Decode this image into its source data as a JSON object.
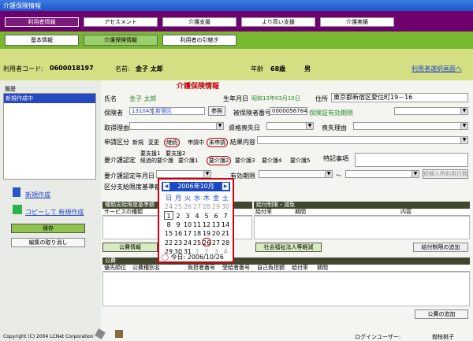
{
  "window": {
    "title": "介護保険情報"
  },
  "top_tabs": [
    "利用者情報",
    "アセスメント",
    "介護支援",
    "より高い支援",
    "介護実績"
  ],
  "sub_tabs": [
    "基本情報",
    "介護保険情報",
    "利用者の引継ぎ"
  ],
  "user": {
    "code_label": "利用者コード:",
    "code": "0600018197",
    "name_label": "名前:",
    "name": "金子 太郎",
    "age_label": "年齢",
    "age": "68歳",
    "gender": "男",
    "select_link": "利用者選択画面へ"
  },
  "sidebar": {
    "history_label": "履歴",
    "history_item": "新規作成中",
    "new_link": "新規作成",
    "copy_link": "コピーして 新規作成",
    "save": "保存",
    "cancel": "編集の取り消し"
  },
  "form": {
    "title": "介護保険情報",
    "name_label": "氏名",
    "name": "金子 太郎",
    "birth_label": "生年月日",
    "birth": "昭和13年03月10日",
    "address_label": "住所",
    "address": "東京都新宿区愛住町19－16",
    "insurer_label": "保険者",
    "insurer_code": "131045",
    "insurer_name": "新宿区",
    "ref": "参照",
    "insured_no_label": "被保険者番号",
    "insured_no": "0000056784",
    "cert_label": "保険証有効期限",
    "acq_label": "取得理由",
    "loss_label": "資格喪失日",
    "loss_reason_label": "喪失理由",
    "app_label": "申請区分",
    "app_opts": [
      "新規",
      "変更",
      "継続",
      "申請中",
      "未申請"
    ],
    "result_label": "結果内容",
    "care_label": "要介護認定",
    "care_row1": [
      "要支援1",
      "要支援2"
    ],
    "care_row2": [
      "経過的要介護",
      "要介護1",
      "要介護2",
      "要介護3",
      "要介護4",
      "要介護5"
    ],
    "special_label": "特記事項",
    "care_date_label": "要介護認定年月日",
    "valid_label": "有効期限",
    "tilde": "～",
    "short_btn": "短期入所利用日数",
    "limit_label": "区分支給限度基準額",
    "type_section": "種類支給限度基準額",
    "service_col": "サービスの種類",
    "limit_section": "給付制限・減免",
    "rate_col": "給付率",
    "period_col": "期間",
    "content_col": "内容",
    "public_btn": "公費情報",
    "social_btn": "社会福祉法人等軽減",
    "limit_add_btn": "給付制限の追加",
    "public_section": "公費",
    "public_cols": [
      "優先順位",
      "公費種別名",
      "負担者番号",
      "受給者番号",
      "自己負担額",
      "給付率",
      "期間"
    ],
    "public_add_btn": "公費の追加"
  },
  "calendar": {
    "month": "2006年10月",
    "days": [
      "日",
      "月",
      "火",
      "水",
      "木",
      "金",
      "土"
    ],
    "weeks": [
      [
        "24",
        "25",
        "26",
        "27",
        "28",
        "29",
        "30"
      ],
      [
        "1",
        "2",
        "3",
        "4",
        "5",
        "6",
        "7"
      ],
      [
        "8",
        "9",
        "10",
        "11",
        "12",
        "13",
        "14"
      ],
      [
        "15",
        "16",
        "17",
        "18",
        "19",
        "20",
        "21"
      ],
      [
        "22",
        "23",
        "24",
        "25",
        "26",
        "27",
        "28"
      ],
      [
        "29",
        "30",
        "31",
        "1",
        "2",
        "3",
        "4"
      ]
    ],
    "today": "今日: 2006/10/26"
  },
  "footer": {
    "copyright": "Copyright (C) 2004 LCNet Corporation",
    "login_label": "ログインユーザー:",
    "login_user": "撥枝桃子"
  }
}
